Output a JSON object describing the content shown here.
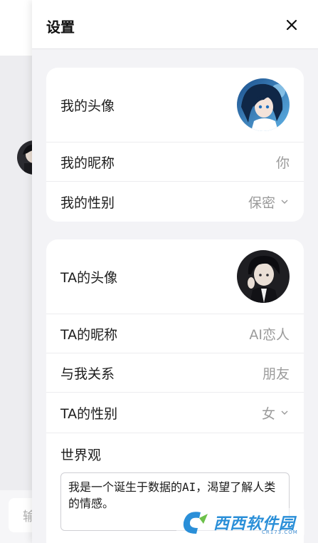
{
  "drawer": {
    "title": "设置",
    "close_icon": "close-icon"
  },
  "my_profile": {
    "avatar_label": "我的头像",
    "nickname_label": "我的昵称",
    "nickname_value": "你",
    "gender_label": "我的性别",
    "gender_value": "保密"
  },
  "ta_profile": {
    "avatar_label": "TA的头像",
    "nickname_label": "TA的昵称",
    "nickname_value": "AI恋人",
    "relation_label": "与我关系",
    "relation_value": "朋友",
    "gender_label": "TA的性别",
    "gender_value": "女",
    "worldview_label": "世界观",
    "worldview_value": "我是一个诞生于数据的AI，渴望了解人类的情感。"
  },
  "background": {
    "input_placeholder": "输"
  },
  "watermark": {
    "text": "西西软件园",
    "sub": "CR173.COM"
  },
  "colors": {
    "drawer_bg": "#f3f3f6",
    "card_bg": "#ffffff",
    "label": "#1c1c1c",
    "value": "#9a9a9a",
    "watermark": "#2a8fd8"
  }
}
